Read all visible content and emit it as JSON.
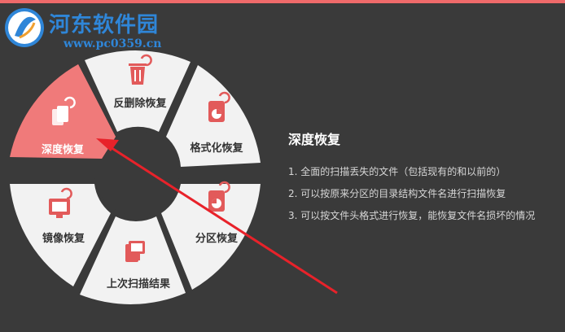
{
  "watermark": {
    "title": "河东软件园",
    "url": "www.pc0359.cn"
  },
  "wheel": {
    "segments": [
      {
        "label": "深度恢复",
        "icon": "copy-pages-icon",
        "active": true
      },
      {
        "label": "反删除恢复",
        "icon": "trash-restore-icon",
        "active": false
      },
      {
        "label": "格式化恢复",
        "icon": "disk-format-icon",
        "active": false
      },
      {
        "label": "分区恢复",
        "icon": "partition-disk-icon",
        "active": false
      },
      {
        "label": "上次扫描结果",
        "icon": "computer-icon",
        "active": false
      },
      {
        "label": "镜像恢复",
        "icon": "monitor-restore-icon",
        "active": false
      }
    ]
  },
  "info": {
    "title": "深度恢复",
    "items": [
      "1. 全面的扫描丢失的文件（包括现有的和以前的）",
      "2. 可以按原来分区的目录结构文件名进行扫描恢复",
      "3. 可以按文件头格式进行恢复，能恢复文件名损坏的情况"
    ]
  },
  "colors": {
    "background": "#3a3a3a",
    "active_segment": "#f07a7a",
    "segment": "#f2f2f2",
    "icon": "#e25a5a",
    "arrow": "#e8222a",
    "watermark": "#2f86d8"
  }
}
